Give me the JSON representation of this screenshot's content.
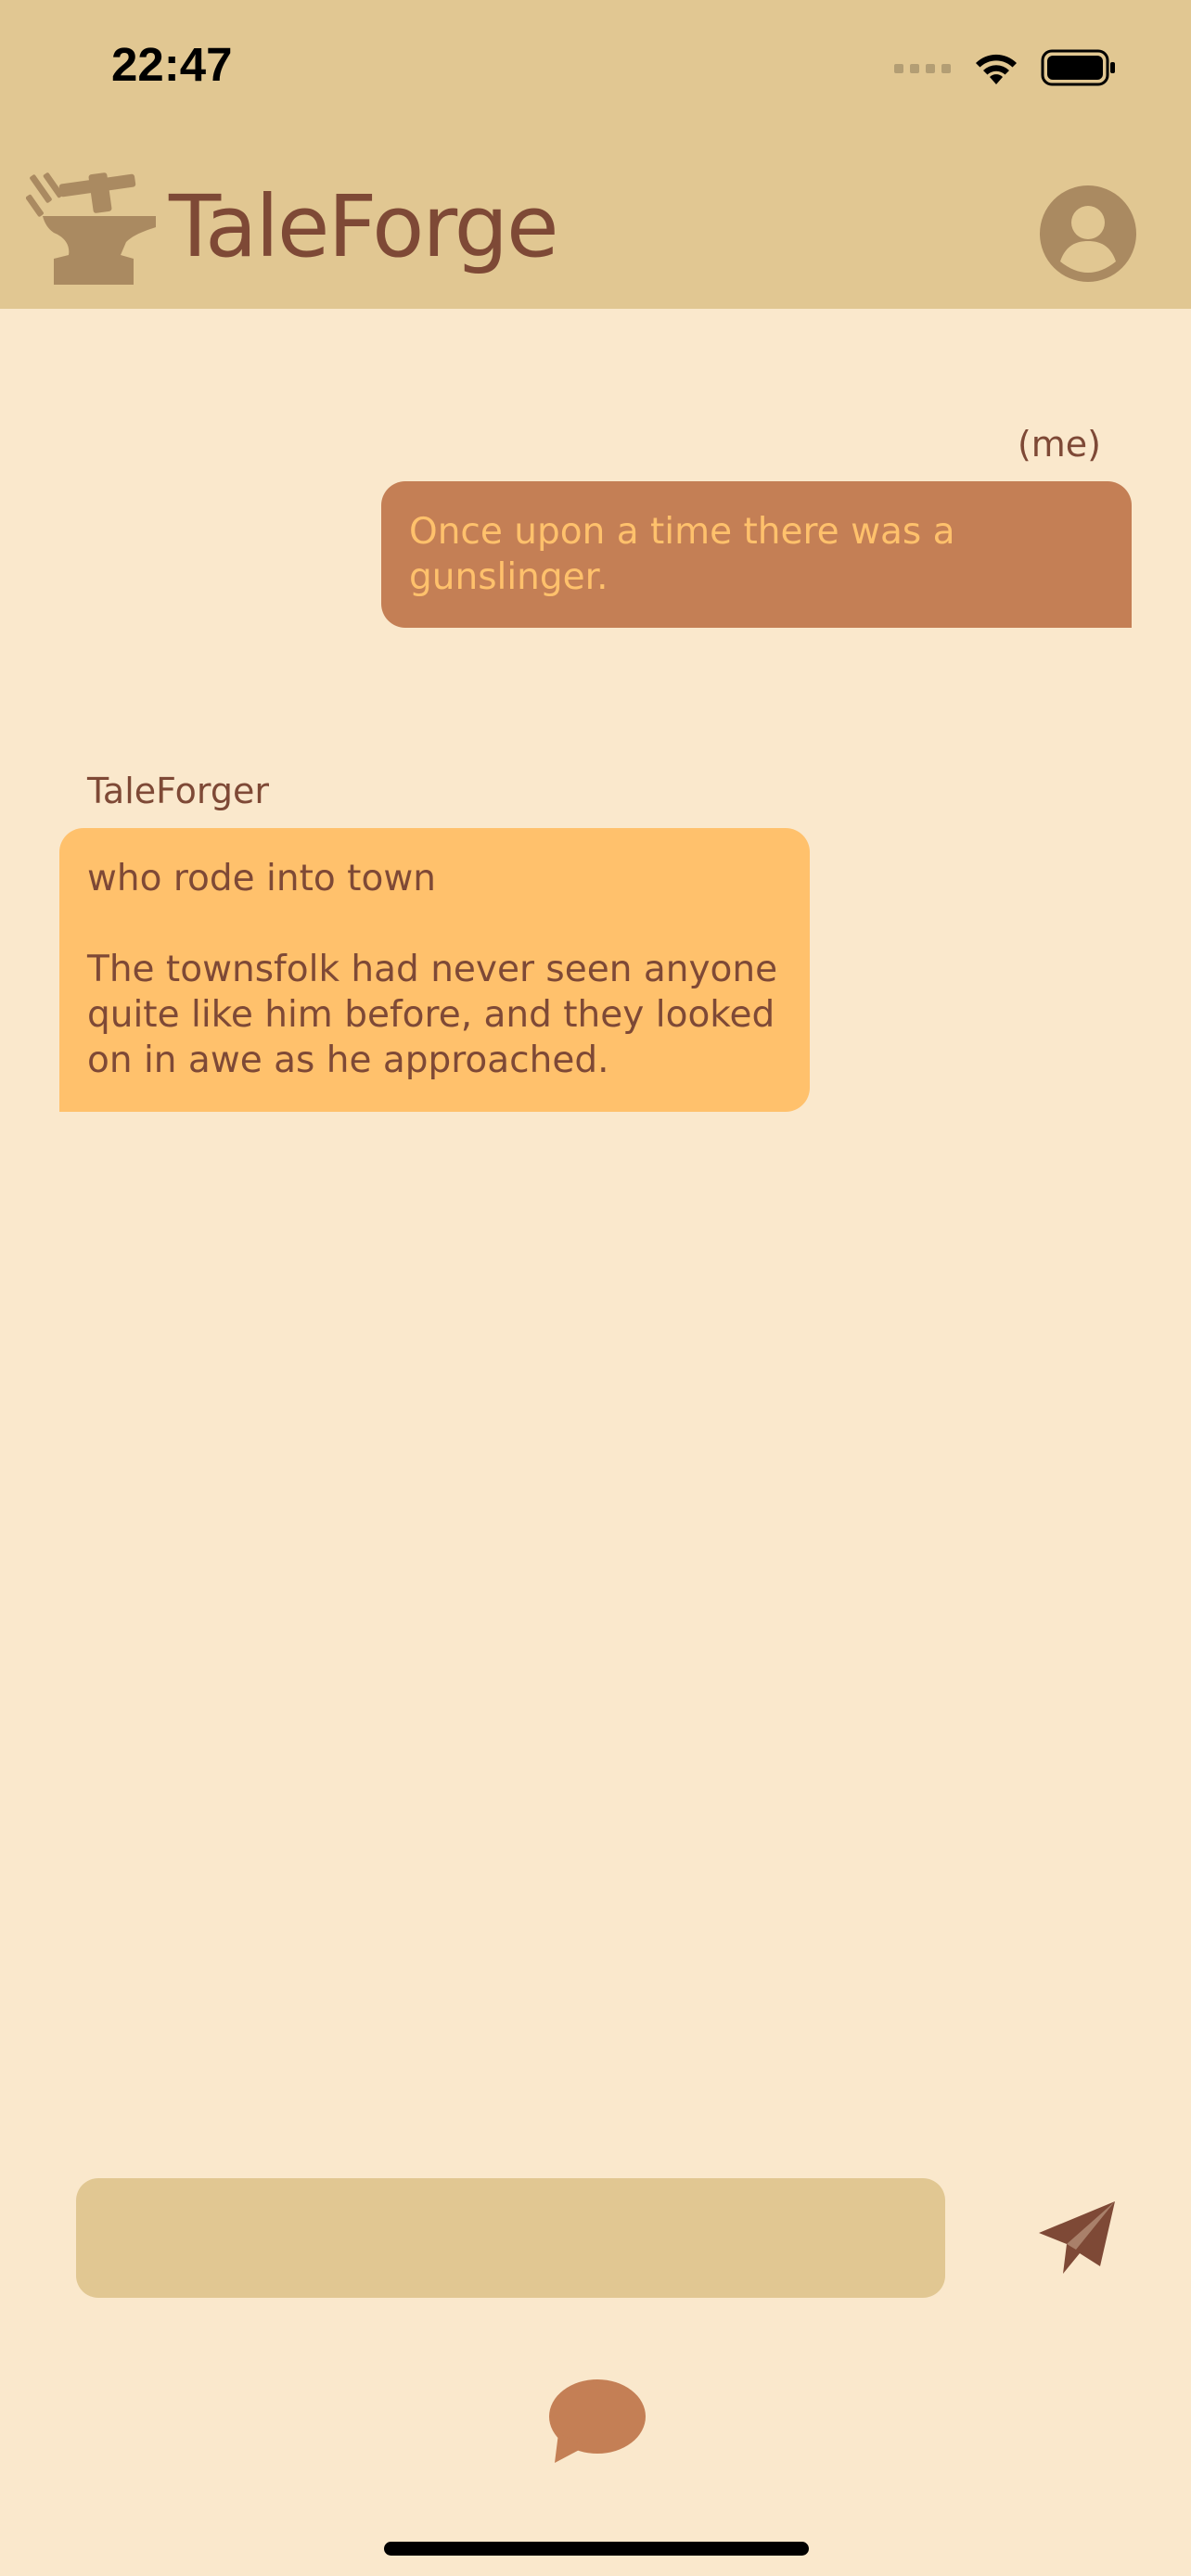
{
  "status_bar": {
    "time": "22:47"
  },
  "header": {
    "app_name": "TaleForge",
    "logo_icon": "anvil-hammer-icon",
    "profile_icon": "user-avatar-icon"
  },
  "conversation": {
    "messages": [
      {
        "author": "(me)",
        "text": "Once upon a time there was a gunslinger."
      },
      {
        "author": "TaleForger",
        "text": "who rode into town\n\nThe townsfolk had never seen anyone quite like him before, and they looked on in awe as he approached."
      }
    ]
  },
  "composer": {
    "value": "",
    "send_icon": "paper-plane-icon"
  },
  "bottom_nav": {
    "chat_icon": "chat-bubble-icon"
  },
  "colors": {
    "header_bg": "#E1C792",
    "page_bg": "#FAE8CC",
    "user_bubble": "#C47F55",
    "bot_bubble": "#FFC16C",
    "text_brown": "#7E4936",
    "logo_tan": "#AA8A61"
  }
}
